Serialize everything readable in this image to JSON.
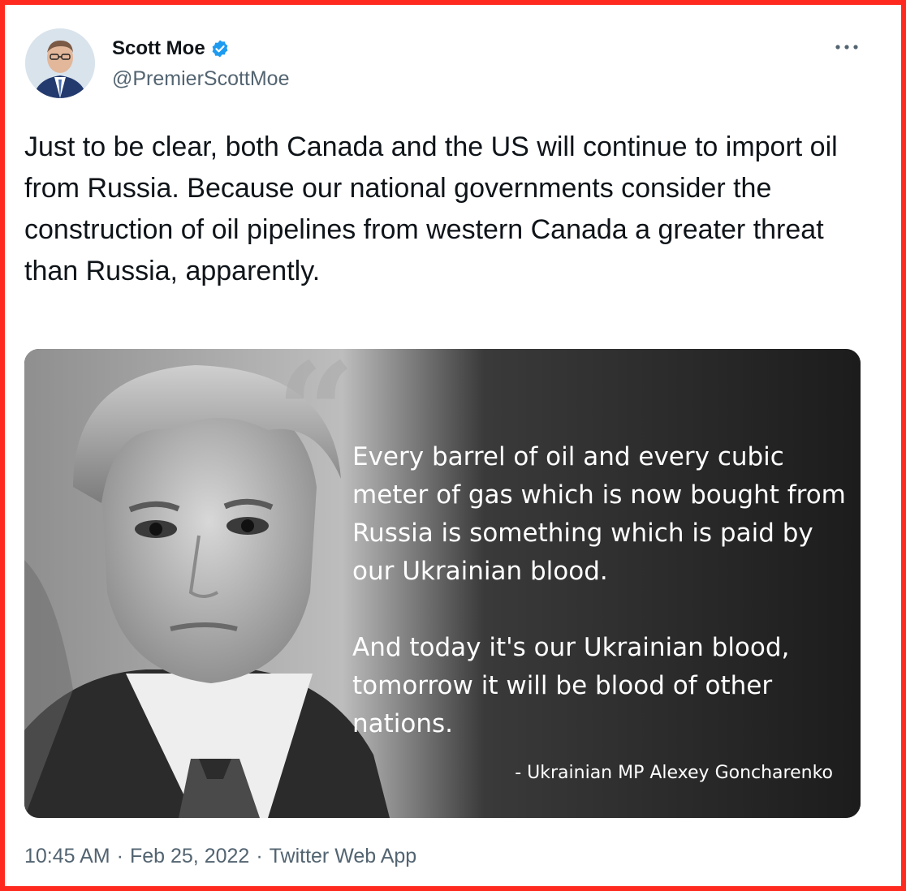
{
  "author": {
    "name": "Scott Moe",
    "handle": "@PremierScottMoe",
    "verified": true,
    "avatar_icon": "person-portrait-icon"
  },
  "tweet": {
    "text": "Just to be clear, both Canada and the US will continue to import oil from Russia. Because our national governments consider the construction of oil pipelines from western Canada a greater threat than Russia, apparently."
  },
  "media": {
    "quote_mark": "“",
    "quote_paragraph_1": "Every barrel of oil and every cubic meter of gas which is now bought from Russia is something which is paid by our Ukrainian blood.",
    "quote_paragraph_2": "And today it's our Ukrainian blood, tomorrow it will be blood of other nations.",
    "attribution": "- Ukrainian MP Alexey Goncharenko"
  },
  "meta": {
    "time": "10:45 AM",
    "separator": "·",
    "date": "Feb 25, 2022",
    "source": "Twitter Web App"
  },
  "colors": {
    "frame_border": "#ff2a1f",
    "verified_blue": "#1d9bf0",
    "secondary_text": "#536471"
  }
}
